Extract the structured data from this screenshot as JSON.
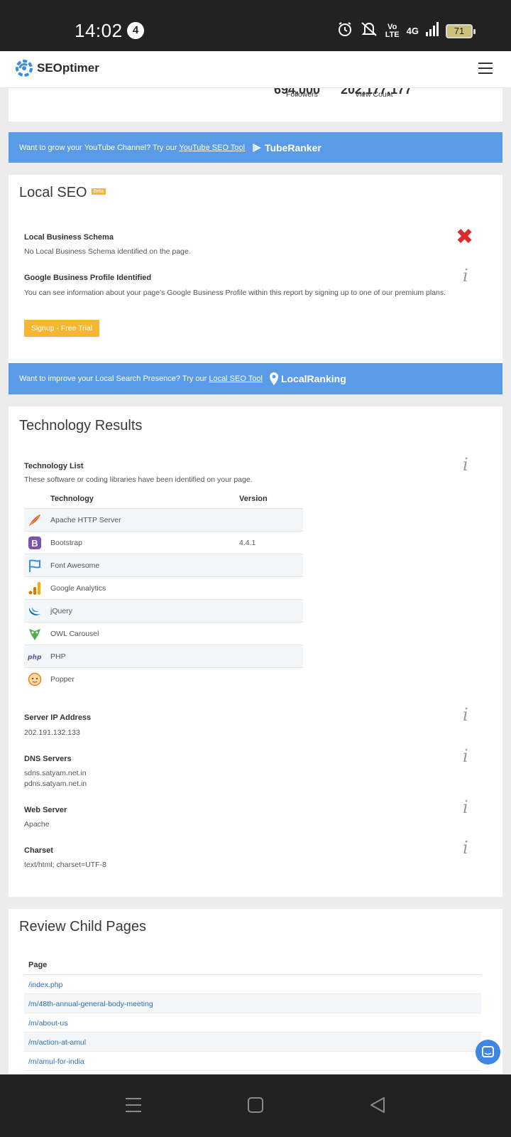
{
  "status_bar": {
    "time": "14:02",
    "notification_count": "4",
    "volte": "Vo\nLTE",
    "network": "4G",
    "battery": "71"
  },
  "header": {
    "logo_text": "SEOptimer"
  },
  "stats": {
    "followers_value": "694,000",
    "followers_label": "Followers",
    "views_value": "202,177,177",
    "views_label": "View Count"
  },
  "youtube_banner": {
    "text": "Want to grow your YouTube Channel? Try our",
    "link": "YouTube SEO Tool",
    "brand": "TubeRanker"
  },
  "local_seo": {
    "title": "Local SEO",
    "badge": "Beta",
    "schema_label": "Local Business Schema",
    "schema_text": "No Local Business Schema identified on the page.",
    "gbp_label": "Google Business Profile Identified",
    "gbp_text": "You can see information about your page's Google Business Profile within this report by signing up to one of our premium plans.",
    "signup_button": "Signup - Free Trial"
  },
  "local_banner": {
    "text": "Want to improve your Local Search Presence? Try our",
    "link": "Local SEO Tool",
    "brand": "LocalRanking"
  },
  "technology": {
    "title": "Technology Results",
    "list_label": "Technology List",
    "list_text": "These software or coding libraries have been identified on your page.",
    "col_technology": "Technology",
    "col_version": "Version",
    "rows": [
      {
        "name": "Apache HTTP Server",
        "version": ""
      },
      {
        "name": "Bootstrap",
        "version": "4.4.1"
      },
      {
        "name": "Font Awesome",
        "version": ""
      },
      {
        "name": "Google Analytics",
        "version": ""
      },
      {
        "name": "jQuery",
        "version": ""
      },
      {
        "name": "OWL Carousel",
        "version": ""
      },
      {
        "name": "PHP",
        "version": ""
      },
      {
        "name": "Popper",
        "version": ""
      }
    ],
    "ip_label": "Server IP Address",
    "ip_value": "202.191.132.133",
    "dns_label": "DNS Servers",
    "dns_1": "sdns.satyam.net.in",
    "dns_2": "pdns.satyam.net.in",
    "web_label": "Web Server",
    "web_value": "Apache",
    "charset_label": "Charset",
    "charset_value": "text/html; charset=UTF-8"
  },
  "child_pages": {
    "title": "Review Child Pages",
    "col_page": "Page",
    "rows": [
      "/index.php",
      "/m/48th-annual-general-body-meeting",
      "/m/about-us",
      "/m/action-at-amul",
      "/m/amul-for-india"
    ]
  },
  "icons": [
    "alarm-icon",
    "mute-icon",
    "signal-icon",
    "battery-icon",
    "menu-icon",
    "info-icon",
    "close-icon",
    "chat-icon"
  ],
  "colors": {
    "banner": "#5a9be8",
    "button": "#f5b731",
    "link": "#2f6fb3",
    "error": "#d92b2b"
  }
}
